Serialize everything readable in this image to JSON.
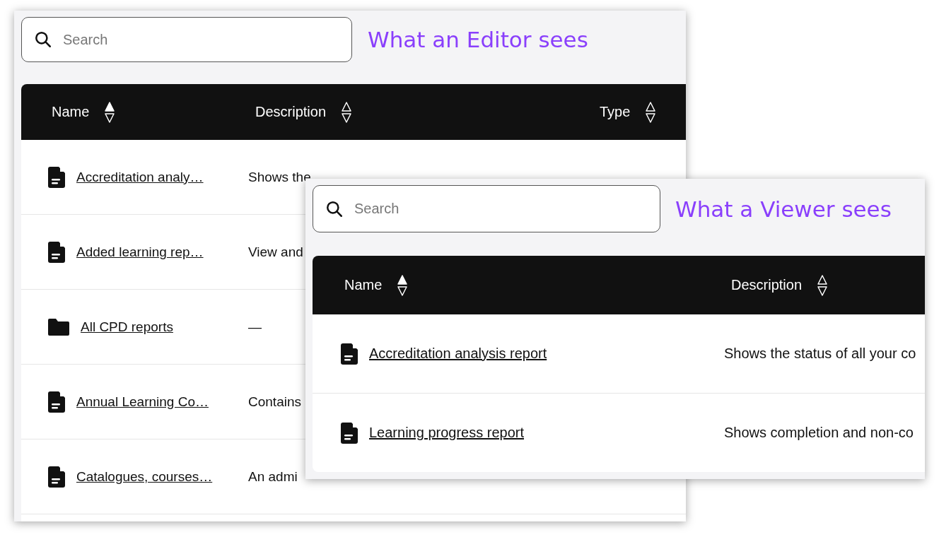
{
  "panels": [
    {
      "search": {
        "placeholder": "Search"
      },
      "heading": "What an Editor sees",
      "columns": [
        {
          "label": "Name",
          "sorted": true
        },
        {
          "label": "Description",
          "sorted": false
        },
        {
          "label": "Type",
          "sorted": false
        }
      ],
      "rows": [
        {
          "kind": "report",
          "name": "Accreditation analy…",
          "description": "Shows the"
        },
        {
          "kind": "report",
          "name": "Added learning rep…",
          "description": "View and"
        },
        {
          "kind": "folder",
          "name": "All CPD reports",
          "description": "—"
        },
        {
          "kind": "report",
          "name": "Annual Learning Co…",
          "description": "Contains"
        },
        {
          "kind": "report",
          "name": "Catalogues, courses…",
          "description": "An admi"
        }
      ]
    },
    {
      "search": {
        "placeholder": "Search"
      },
      "heading": "What a Viewer sees",
      "columns": [
        {
          "label": "Name",
          "sorted": true
        },
        {
          "label": "Description",
          "sorted": false
        }
      ],
      "rows": [
        {
          "kind": "report",
          "name": "Accreditation analysis report",
          "description": "Shows the status of all your co"
        },
        {
          "kind": "report",
          "name": "Learning progress report",
          "description": "Shows completion and non-co"
        }
      ]
    }
  ]
}
